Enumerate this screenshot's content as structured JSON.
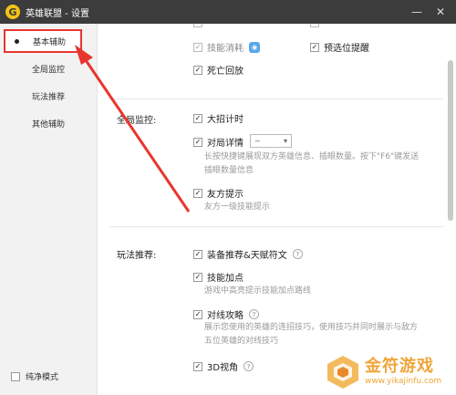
{
  "window": {
    "title": "英雄联盟 - 设置",
    "logo_letter": "G",
    "min_glyph": "—",
    "close_glyph": "✕"
  },
  "sidebar": {
    "items": [
      {
        "label": "基本辅助",
        "active": true
      },
      {
        "label": "全局监控"
      },
      {
        "label": "玩法推荐"
      },
      {
        "label": "其他辅助"
      }
    ],
    "clean_mode": "纯净模式"
  },
  "content": {
    "basic": {
      "skill_cost": "技能消耗",
      "preselect_remind": "预选位提醒",
      "death_replay": "死亡回放"
    },
    "global_monitor": {
      "label": "全局监控:",
      "ult_timer": "大招计时",
      "match_detail": "对局详情",
      "match_detail_select": "~",
      "match_detail_desc": "长按快捷键展现双方英雄信息、插眼数量。按下\"F6\"键发送插眼数量信息",
      "ally_hint": "友方提示",
      "ally_hint_desc": "友方一级技能提示"
    },
    "play_recommend": {
      "label": "玩法推荐:",
      "equip_rune": "装备推荐&天赋符文",
      "skill_points": "技能加点",
      "skill_points_desc": "游戏中高亮提示技能加点路线",
      "lane_guide": "对线攻略",
      "lane_guide_desc": "展示您使用的英雄的连招技巧，使用技巧并同时展示与敌方五位英雄的对线技巧",
      "view_3d": "3D视角"
    }
  },
  "watermark": {
    "name": "金符游戏",
    "url": "www.yikajinfu.com"
  },
  "colors": {
    "highlight": "#e8362e",
    "titlebar": "#3c3c3c",
    "watermark": "#f0a53a"
  }
}
